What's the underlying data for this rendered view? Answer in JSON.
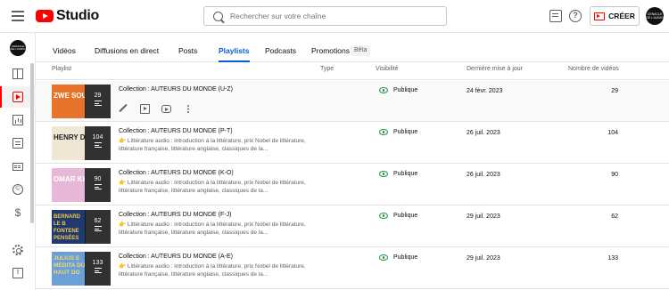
{
  "topbar": {
    "logo_text": "Studio",
    "search_placeholder": "Rechercher sur votre chaîne",
    "create_label": "CRÉER",
    "help_glyph": "?",
    "avatar_text": "CENACLE DE L'AUDIO",
    "icons": [
      "menu-icon",
      "youtube-logo-icon",
      "search-icon",
      "feedback-icon",
      "help-icon",
      "create-video-icon"
    ]
  },
  "sidebar": {
    "avatar_text": "CENACLE DE L'AUDIO",
    "copyright_glyph": "©",
    "earn_glyph": "$",
    "feedback_glyph": "!",
    "items": [
      "dashboard-icon",
      "content-icon",
      "analytics-icon",
      "comments-icon",
      "subtitles-icon",
      "copyright-icon",
      "earn-icon",
      "settings-icon",
      "send-feedback-icon"
    ],
    "active": "content-icon"
  },
  "tabs": {
    "videos": "Vidéos",
    "live": "Diffusions en direct",
    "posts": "Posts",
    "playlists": "Playlists",
    "podcasts": "Podcasts",
    "promotions": "Promotions",
    "beta": "Bêta",
    "active": "playlists"
  },
  "table": {
    "headers": {
      "playlist": "Playlist",
      "type": "Type",
      "visibility": "Visibilité",
      "updated": "Dernière mise à jour",
      "count": "Nombre de vidéos"
    },
    "rows": [
      {
        "thumb_text": "ZWE SOUVENIRS",
        "thumb_color": "#e8742c",
        "count_badge": "29",
        "title": "Collection : AUTEURS DU MONDE (U-Z)",
        "description": "",
        "visibility": "Publique",
        "date": "24 févr. 2023",
        "count": "29"
      },
      {
        "thumb_text": "HENRY DAVID THOREAU",
        "thumb_color": "#efe7d4",
        "count_badge": "104",
        "title": "Collection : AUTEURS DU MONDE (P-T)",
        "description": "👉 Littérature audio : introduction à la littérature, prix Nobel de littérature, littérature française, littérature anglaise, classiques de la...",
        "visibility": "Publique",
        "date": "26 juil. 2023",
        "count": "104"
      },
      {
        "thumb_text": "OMAR KH QUATRA",
        "thumb_color": "#e8b8d8",
        "count_badge": "90",
        "title": "Collection : AUTEURS DU MONDE (K-O)",
        "description": "👉 Littérature audio : introduction à la littérature, prix Nobel de littérature, littérature française, littérature anglaise, classiques de la...",
        "visibility": "Publique",
        "date": "26 juil. 2023",
        "count": "90"
      },
      {
        "thumb_text": "BERNARD LE B FONTENE PENSÉES",
        "thumb_color": "#1f3a6e",
        "count_badge": "62",
        "title": "Collection : AUTEURS DU MONDE (F-J)",
        "description": "👉 Littérature audio : introduction à la littérature, prix Nobel de littérature, littérature française, littérature anglaise, classiques de la...",
        "visibility": "Publique",
        "date": "29 juil. 2023",
        "count": "62"
      },
      {
        "thumb_text": "JULIUS E MÉDITA DU HAUT DO",
        "thumb_color": "#6a9fd8",
        "count_badge": "133",
        "title": "Collection : AUTEURS DU MONDE (A-E)",
        "description": "👉 Littérature audio : introduction à la littérature, prix Nobel de littérature, littérature française, littérature anglaise, classiques de la...",
        "visibility": "Publique",
        "date": "29 juil. 2023",
        "count": "133"
      }
    ]
  }
}
